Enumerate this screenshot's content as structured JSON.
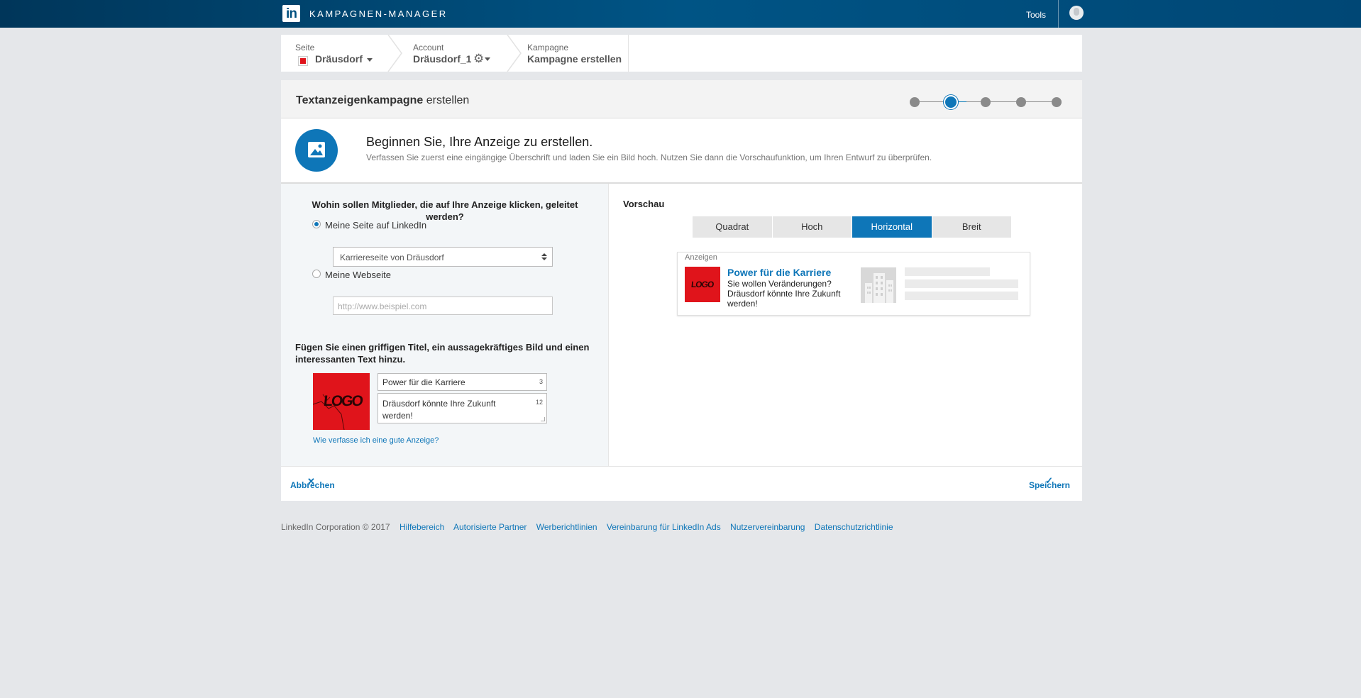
{
  "topbar": {
    "logo_text": "in",
    "app_title": "KAMPAGNEN-MANAGER",
    "tools_label": "Tools"
  },
  "breadcrumb": {
    "page_label": "Seite",
    "page_value": "Dräusdorf",
    "account_label": "Account",
    "account_value": "Dräusdorf_1",
    "campaign_label": "Kampagne",
    "campaign_value": "Kampagne erstellen"
  },
  "header": {
    "title_bold": "Textanzeigenkampagne",
    "title_rest": " erstellen",
    "steps_total": 5,
    "current_step": 2
  },
  "intro": {
    "title": "Beginnen Sie, Ihre Anzeige zu erstellen.",
    "subtitle": "Verfassen Sie zuerst eine eingängige Überschrift und laden Sie ein Bild hoch. Nutzen Sie dann die Vorschaufunktion, um Ihren Entwurf zu überprüfen."
  },
  "destination": {
    "question": "Wohin sollen Mitglieder, die auf Ihre Anzeige klicken, geleitet werden?",
    "option_linkedin": "Meine Seite auf LinkedIn",
    "linkedin_select_value": "Karriereseite von Dräusdorf",
    "option_website": "Meine Webseite",
    "website_placeholder": "http://www.beispiel.com",
    "selected": "linkedin"
  },
  "content": {
    "question": "Fügen Sie einen griffigen Titel, ein aussagekräftiges Bild und einen interessanten Text hinzu.",
    "image_logo_text": "LOGO",
    "title_value": "Power für die Karriere",
    "title_counter": "3",
    "text_value": "Dräusdorf könnte Ihre Zukunft werden!",
    "text_counter": "12",
    "help_link": "Wie verfasse ich eine gute Anzeige?"
  },
  "preview": {
    "label": "Vorschau",
    "tabs": [
      "Quadrat",
      "Hoch",
      "Horizontal",
      "Breit"
    ],
    "active_tab": "Horizontal",
    "ad_header": "Anzeigen",
    "ad_title": "Power für die Karriere",
    "ad_text": "Sie wollen Veränderungen? Dräusdorf könnte Ihre Zukunft werden!",
    "logo_text": "LOGO"
  },
  "actions": {
    "cancel": "Abbrechen",
    "save": "Speichern"
  },
  "footer": {
    "copyright": "LinkedIn Corporation © 2017",
    "links": [
      "Hilfebereich",
      "Autorisierte Partner",
      "Werberichtlinien",
      "Vereinbarung für LinkedIn Ads",
      "Nutzervereinbarung",
      "Datenschutzrichtlinie"
    ]
  },
  "colors": {
    "accent": "#0e76b8",
    "topbar": "#005485",
    "logo_red": "#e0141b"
  }
}
